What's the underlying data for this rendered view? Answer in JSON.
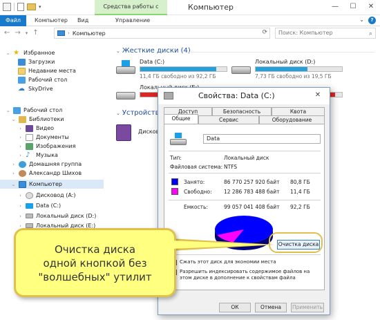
{
  "window": {
    "title": "Компьютер",
    "context_tab": "Средства работы с дисками"
  },
  "ribbon": {
    "tabs": [
      "Файл",
      "Компьютер",
      "Вид",
      "Управление"
    ]
  },
  "address": {
    "path": "Компьютер",
    "search_placeholder": "Поиск: Компьютер"
  },
  "sidebar": {
    "favorites": "Избранное",
    "fav_items": [
      "Загрузки",
      "Недавние места",
      "Рабочий стол",
      "SkyDrive"
    ],
    "desktop": "Рабочий стол",
    "libraries": "Библиотеки",
    "lib_items": [
      "Видео",
      "Документы",
      "Изображения",
      "Музыка"
    ],
    "homegroup": "Домашняя группа",
    "user": "Александр Шихов",
    "computer": "Компьютер",
    "comp_items": [
      "Дисковод (A:)",
      "Data (C:)",
      "Локальный диск (D:)",
      "Локальный диск (E:)"
    ]
  },
  "main": {
    "hdd_header": "Жесткие диски (4)",
    "devices_header": "Устройства с",
    "drives": [
      {
        "name": "Data (C:)",
        "free": "11,4 ГБ свободно из 92,2 ГБ",
        "used_fraction": 0.88
      },
      {
        "name": "Локальный диск (D:)",
        "free": "7,73 ГБ свободно из 19,5 ГБ",
        "used_fraction": 0.6
      },
      {
        "name": "Локальный диск (E:)",
        "free": "",
        "used_fraction": 0.93
      },
      {
        "name": "",
        "free": "",
        "used_fraction": 0.92
      }
    ],
    "device_name": "Дисков"
  },
  "dialog": {
    "title": "Свойства: Data (C:)",
    "close": "✕",
    "tabs_top": [
      "Доступ",
      "Безопасность",
      "Квота"
    ],
    "tabs_bottom": [
      "Общие",
      "Сервис",
      "Оборудование"
    ],
    "volume_name": "Data",
    "type_label": "Тип:",
    "type_value": "Локальный диск",
    "fs_label": "Файловая система:",
    "fs_value": "NTFS",
    "used_label": "Занято:",
    "used_bytes": "86 770 257 920 байт",
    "used_gb": "80,8 ГБ",
    "free_label": "Свободно:",
    "free_bytes": "12 286 783 488 байт",
    "free_gb": "11,4 ГБ",
    "capacity_label": "Емкость:",
    "capacity_bytes": "99 057 041 408 байт",
    "capacity_gb": "92,2 ГБ",
    "disk_label": "Диск С:",
    "cleanup_button": "Очистка диска",
    "compress_label": "Сжать этот диск для экономии места",
    "index_label": "Разрешить индексировать содержимое файлов на этом диске в дополнение к свойствам файла",
    "ok": "ОК",
    "cancel": "Отмена",
    "apply": "Применить",
    "used_color": "#0000ff",
    "free_color": "#ff00ff",
    "used_fraction": 0.876
  },
  "callout": {
    "line1": "Очистка диска",
    "line2": "одной кнопкой без",
    "line3": "\"волшебных\" утилит"
  }
}
